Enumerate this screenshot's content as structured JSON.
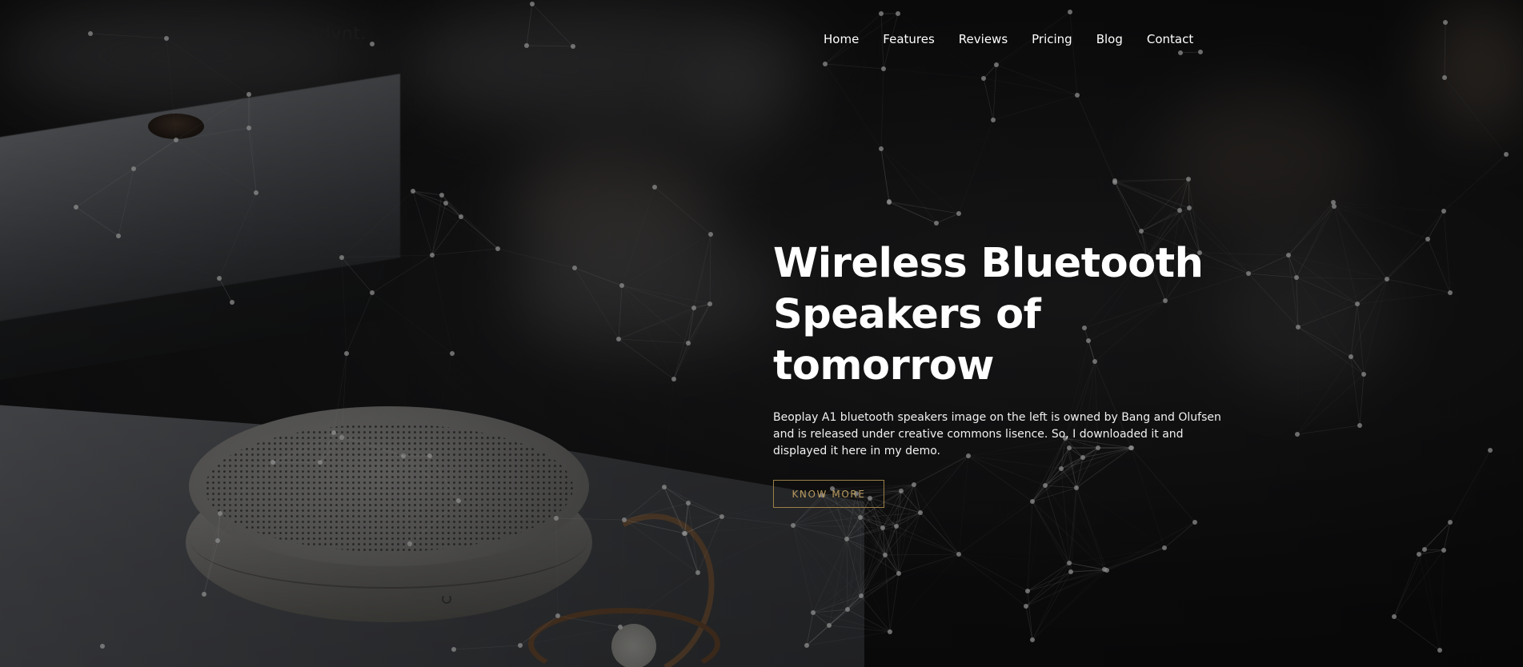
{
  "brand": {
    "logo": "advnt."
  },
  "nav": {
    "items": [
      {
        "label": "Home"
      },
      {
        "label": "Features"
      },
      {
        "label": "Reviews"
      },
      {
        "label": "Pricing"
      },
      {
        "label": "Blog"
      },
      {
        "label": "Contact"
      }
    ]
  },
  "hero": {
    "headline_line1": "Wireless Bluetooth",
    "headline_line2": "Speakers of",
    "headline_line3": "tomorrow",
    "description": "Beoplay A1 bluetooth speakers image on the left is owned by Bang and Olufsen and is released under creative commons lisence. So, I downloaded it and displayed it here in my demo.",
    "cta_label": "KNOW MORE"
  },
  "colors": {
    "accent": "#b79a5f",
    "text": "#ffffff",
    "logo": "#1a1a1a"
  }
}
